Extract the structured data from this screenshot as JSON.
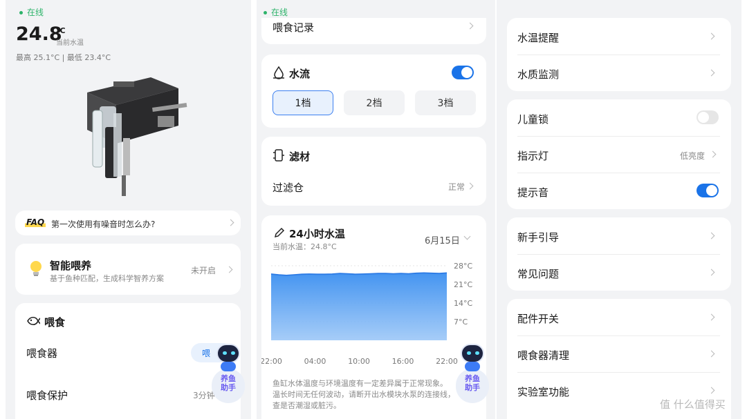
{
  "panel1": {
    "status": "在线",
    "temp_value": "24.8",
    "temp_unit": "°C",
    "temp_caption": "当前水温",
    "temp_range": "最高 25.1°C | 最低 23.4°C",
    "faq_badge": "FAQ",
    "faq_text": "第一次使用有噪音时怎么办?",
    "smart_title": "智能喂养",
    "smart_desc": "基于鱼种匹配，生成科学智养方案",
    "smart_status": "未开启",
    "feed_title": "喂食",
    "feeder_label": "喂食器",
    "feeder_btn": "喂",
    "feed_protect_label": "喂食保护",
    "feed_protect_value": "3分钟"
  },
  "panel2": {
    "status": "在线",
    "feed_record": "喂食记录",
    "flow_title": "水流",
    "flow_on": true,
    "speeds": [
      "1档",
      "2档",
      "3档"
    ],
    "speed_selected": "1档",
    "filter_title": "滤材",
    "filter_bin": "过滤仓",
    "filter_status": "正常",
    "chart_title": "24小时水温",
    "chart_current": "当前水温：24.8°C",
    "chart_date": "6月15日",
    "note_line1": "鱼缸水体温度与环境温度有一定差异属于正常现象。",
    "note_line2": "温长时间无任何波动，请断开出水模块水泵的连接线，",
    "note_line3": "查是否潮湿或脏污。"
  },
  "chart_data": {
    "type": "area",
    "title": "24小时水温",
    "x_ticks": [
      "22:00",
      "04:00",
      "10:00",
      "16:00",
      "22:00"
    ],
    "y_ticks": [
      "28°C",
      "21°C",
      "14°C",
      "7°C"
    ],
    "ylim": [
      0,
      28
    ],
    "values": [
      24.9,
      24.6,
      24.4,
      24.6,
      24.8,
      24.9,
      24.8,
      24.8,
      24.9,
      25.1,
      25.0,
      24.8,
      24.9,
      25.0,
      25.1,
      25.1,
      25.0,
      25.1,
      25.0,
      25.2,
      25.3,
      25.2,
      25.1,
      25.3
    ],
    "color": "#3b8ff0"
  },
  "panel3": {
    "temp_reminder": "水温提醒",
    "water_quality": "水质监测",
    "child_lock": "儿童锁",
    "child_lock_on": false,
    "indicator": "指示灯",
    "indicator_value": "低亮度",
    "sound": "提示音",
    "sound_on": true,
    "guide": "新手引导",
    "faq": "常见问题",
    "accessory": "配件开关",
    "feeder_clean": "喂食器清理",
    "lab": "实验室功能"
  },
  "assistant": {
    "line1": "养鱼",
    "line2": "助手"
  },
  "watermark": "值 什么值得买",
  "colors": {
    "accent": "#1a73e8",
    "online": "#2db36a",
    "area": "#3b8ff0"
  }
}
